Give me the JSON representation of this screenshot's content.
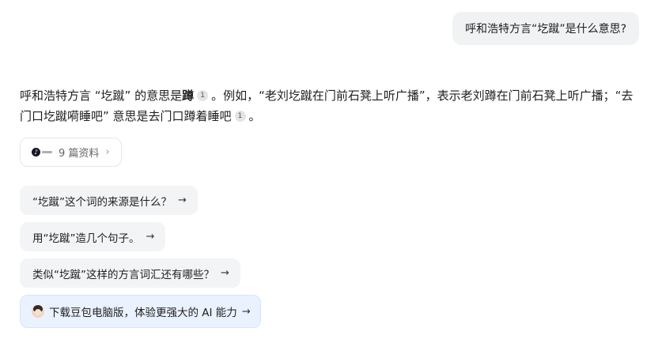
{
  "user_message": "呼和浩特方言“圪蹴”是什么意思?",
  "answer": {
    "part1": "呼和浩特方言 “圪蹴” 的意思是",
    "bold_word": "蹲",
    "cite1": "1",
    "part2": "。例如，“老刘圪蹴在门前石凳上听广播”，表示老刘蹲在门前石凳上听广播；“去门口圪蹴嗬睡吧” 意思是去门口蹲着睡吧",
    "cite2": "1",
    "part3": "。"
  },
  "sources": {
    "label": "9 篇资料",
    "logo": "tiktok-logo",
    "chevron": "›"
  },
  "suggestions": [
    {
      "text": "“圪蹴”这个词的来源是什么？",
      "arrow": "→"
    },
    {
      "text": "用“圪蹴”造几个句子。",
      "arrow": "→"
    },
    {
      "text": "类似“圪蹴”这样的方言词汇还有哪些？",
      "arrow": "→"
    }
  ],
  "promo": {
    "text": "下载豆包电脑版，体验更强大的 AI 能力",
    "arrow": "→"
  },
  "colors": {
    "bubble_bg": "#f1f2f4",
    "suggestion_bg": "#f3f4f6",
    "promo_bg": "#eaf2ff"
  }
}
